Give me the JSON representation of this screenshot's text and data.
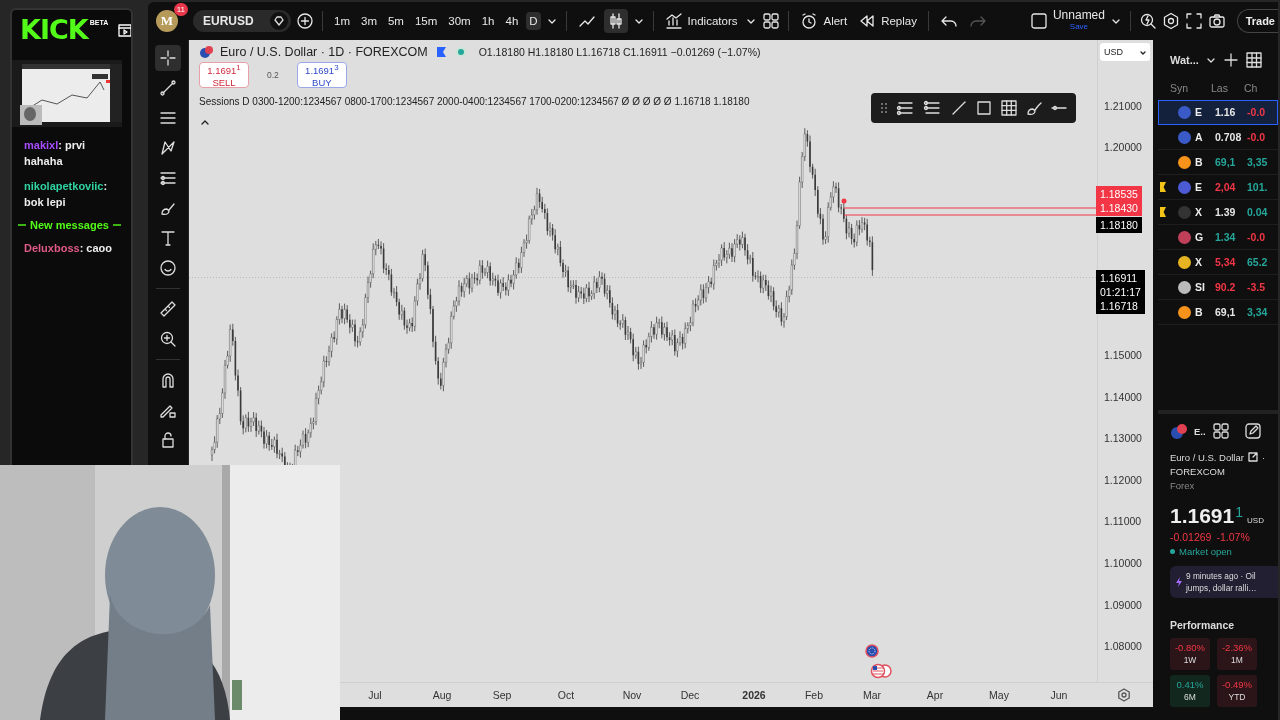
{
  "chat": {
    "logo": "KICK",
    "badge": "BETA",
    "messages": [
      {
        "kind": "message",
        "user": "makixl",
        "color": "#a64dff",
        "text": ": prvi hahaha"
      },
      {
        "kind": "message",
        "user": "nikolapetkoviic",
        "color": "#2fd3a1",
        "text": ": bok lepi"
      },
      {
        "kind": "divider",
        "text": "New messages"
      },
      {
        "kind": "message",
        "user": "Deluxboss",
        "color": "#e05a86",
        "text": ": caoo"
      }
    ]
  },
  "toolbar": {
    "avatar": "M",
    "notifications": "11",
    "symbol": "EURUSD",
    "intervals": [
      {
        "label": "1m",
        "selected": false
      },
      {
        "label": "3m",
        "selected": false
      },
      {
        "label": "5m",
        "selected": false
      },
      {
        "label": "15m",
        "selected": false
      },
      {
        "label": "30m",
        "selected": false
      },
      {
        "label": "1h",
        "selected": false
      },
      {
        "label": "4h",
        "selected": false
      },
      {
        "label": "D",
        "selected": true
      }
    ],
    "chart_types": [
      {
        "kind": "line",
        "selected": false
      },
      {
        "kind": "candles",
        "selected": true
      }
    ],
    "actions": [
      {
        "kind": "indicators",
        "label": "Indicators"
      },
      {
        "kind": "alert",
        "label": "Alert"
      },
      {
        "kind": "replay",
        "label": "Replay"
      }
    ],
    "undo": {
      "disabled": false
    },
    "redo": {
      "disabled": true
    },
    "layout": {
      "name": "Unnamed",
      "status": "Save"
    },
    "trade": "Trade"
  },
  "tools": [
    {
      "kind": "crosshair",
      "selected": true
    },
    {
      "kind": "trend-line",
      "selected": false
    },
    {
      "kind": "fib",
      "selected": false
    },
    {
      "kind": "pattern",
      "selected": false
    },
    {
      "kind": "channel",
      "selected": false
    },
    {
      "kind": "brush",
      "selected": false
    },
    {
      "kind": "text",
      "selected": false
    },
    {
      "kind": "emoji",
      "selected": false
    },
    {
      "kind": "ruler",
      "selected": false
    },
    {
      "kind": "zoom",
      "selected": false
    },
    {
      "kind": "magnet",
      "selected": false
    },
    {
      "kind": "lock-drawing",
      "selected": false
    },
    {
      "kind": "lock",
      "selected": false
    }
  ],
  "chart": {
    "title": "Euro / U.S. Dollar · 1D · FOREXCOM",
    "ohlc": "O1.18180 H1.18180 L1.16718 C1.16911 −0.01269 (−1.07%)",
    "sell": {
      "price": "1.1691$^{1}$",
      "label": "SELL"
    },
    "spread": "0.2",
    "buy": {
      "price": "1.1691$^{3}$",
      "label": "BUY"
    },
    "sessions": "Sessions D 0300-1200:1234567 0800-1700:1234567 2000-0400:1234567 1700-0200:1234567 Ø Ø Ø Ø Ø 1.16718 1.18180",
    "currency": "USD",
    "price_axis": [
      "1.21000",
      "1.20000",
      "1.15000",
      "1.14000",
      "1.13000",
      "1.12000",
      "1.11000",
      "1.10000",
      "1.09000",
      "1.08000"
    ],
    "price_tags": [
      {
        "kind": "alert",
        "lines": [
          "1.18535",
          "1.18430"
        ]
      },
      {
        "kind": "high",
        "lines": [
          "1.18180"
        ]
      },
      {
        "kind": "last",
        "lines": [
          "1.16911",
          "01:21:17",
          "1.16718"
        ]
      }
    ],
    "time_axis": [
      {
        "kind": "month",
        "label": "Jul"
      },
      {
        "kind": "month",
        "label": "Aug"
      },
      {
        "kind": "month",
        "label": "Sep"
      },
      {
        "kind": "month",
        "label": "Oct"
      },
      {
        "kind": "month",
        "label": "Nov"
      },
      {
        "kind": "month",
        "label": "Dec"
      },
      {
        "kind": "year",
        "label": "2026"
      },
      {
        "kind": "month",
        "label": "Feb"
      },
      {
        "kind": "month",
        "label": "Mar"
      },
      {
        "kind": "month",
        "label": "Apr"
      },
      {
        "kind": "month",
        "label": "May"
      },
      {
        "kind": "month",
        "label": "Jun"
      }
    ]
  },
  "watchlist": {
    "title": "Wat...",
    "columns": [
      "Syn",
      "Las",
      "Ch"
    ],
    "rows": [
      {
        "symbol": "E",
        "last": {
          "text": "1.16",
          "kind": "neutral"
        },
        "change": {
          "text": "-0.0",
          "kind": "down"
        },
        "flagged": false,
        "selected": true
      },
      {
        "symbol": "A",
        "last": {
          "text": "0.708",
          "kind": "neutral"
        },
        "change": {
          "text": "-0.0",
          "kind": "down"
        },
        "flagged": false,
        "selected": false
      },
      {
        "symbol": "B",
        "last": {
          "text": "69,1",
          "kind": "up"
        },
        "change": {
          "text": "3,35",
          "kind": "up"
        },
        "flagged": false,
        "selected": false
      },
      {
        "symbol": "E",
        "last": {
          "text": "2,04",
          "kind": "down"
        },
        "change": {
          "text": "101.",
          "kind": "up"
        },
        "flagged": true,
        "selected": false
      },
      {
        "symbol": "X",
        "last": {
          "text": "1.39",
          "kind": "neutral"
        },
        "change": {
          "text": "0.04",
          "kind": "up"
        },
        "flagged": true,
        "selected": false
      },
      {
        "symbol": "G",
        "last": {
          "text": "1.34",
          "kind": "up"
        },
        "change": {
          "text": "-0.0",
          "kind": "down"
        },
        "flagged": false,
        "selected": false
      },
      {
        "symbol": "X",
        "last": {
          "text": "5,34",
          "kind": "down"
        },
        "change": {
          "text": "65.2",
          "kind": "up"
        },
        "flagged": false,
        "selected": false
      },
      {
        "symbol": "SI",
        "last": {
          "text": "90.2",
          "kind": "down"
        },
        "change": {
          "text": "-3.5",
          "kind": "down"
        },
        "flagged": false,
        "selected": false
      },
      {
        "symbol": "B",
        "last": {
          "text": "69,1",
          "kind": "neutral"
        },
        "change": {
          "text": "3,34",
          "kind": "up"
        },
        "flagged": false,
        "selected": false
      }
    ]
  },
  "details": {
    "symbol": "E..",
    "name": "Euro / U.S. Dollar",
    "separator": "·",
    "exchange": "FOREXCOM",
    "type": "Forex",
    "price": "1.1691",
    "price_tail": "1",
    "currency": "USD",
    "change": "-0.01269",
    "change_percent": "-1.07%",
    "market_status": "Market open",
    "news": "9 minutes ago · Oil jumps, dollar ralli…",
    "performance_title": "Performance",
    "performance": [
      {
        "value": "-0.80%",
        "period": "1W",
        "kind": "down"
      },
      {
        "value": "-2.36%",
        "period": "1M",
        "kind": "down"
      },
      {
        "value": "0.41%",
        "period": "6M",
        "kind": "up"
      },
      {
        "value": "-0.49%",
        "period": "YTD",
        "kind": "down"
      }
    ]
  }
}
